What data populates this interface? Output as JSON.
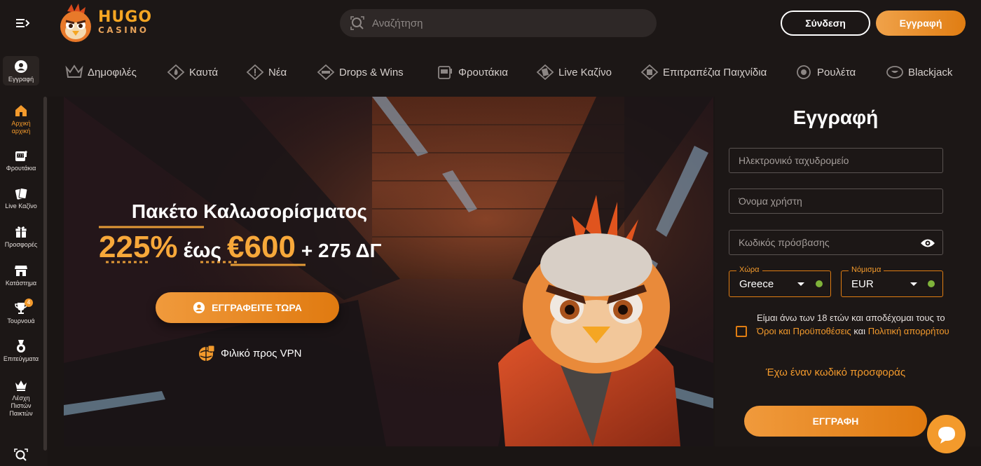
{
  "header": {
    "logo_text": "HUGO",
    "logo_sub": "CASINO",
    "search_placeholder": "Αναζήτηση",
    "login_label": "Σύνδεση",
    "register_label": "Εγγραφή"
  },
  "sidebar": {
    "items": [
      {
        "label": "Εγγραφή",
        "icon": "user-icon"
      },
      {
        "label": "Αρχική αρχική",
        "icon": "home-icon"
      },
      {
        "label": "Φρουτάκια",
        "icon": "slot-machine-icon"
      },
      {
        "label": "Live Καζίνο",
        "icon": "cards-icon"
      },
      {
        "label": "Προσφορές",
        "icon": "gift-icon"
      },
      {
        "label": "Κατάστημα",
        "icon": "store-icon"
      },
      {
        "label": "Τουρνουά",
        "icon": "trophy-icon",
        "badge": "4"
      },
      {
        "label": "Επιτεύγματα",
        "icon": "medal-icon"
      },
      {
        "label": "Λέσχη Πιστών Παικτών",
        "icon": "crown-icon"
      }
    ]
  },
  "categories": [
    {
      "label": "Δημοφιλές",
      "icon": "crown-icon"
    },
    {
      "label": "Καυτά",
      "icon": "fire-icon"
    },
    {
      "label": "Νέα",
      "icon": "new-icon"
    },
    {
      "label": "Drops & Wins",
      "icon": "drops-wins-icon"
    },
    {
      "label": "Φρουτάκια",
      "icon": "slot-machine-icon"
    },
    {
      "label": "Live Καζίνο",
      "icon": "cards-icon"
    },
    {
      "label": "Επιτραπέζια Παιχνίδια",
      "icon": "dice-icon"
    },
    {
      "label": "Ρουλέτα",
      "icon": "roulette-icon"
    },
    {
      "label": "Blackjack",
      "icon": "blackjack-icon"
    }
  ],
  "hero": {
    "title": "Πακέτο Καλωσορίσματος",
    "offer_percent": "225%",
    "offer_upto": "έως",
    "offer_amount": "€600",
    "offer_extra": "+ 275 ΔΓ",
    "cta_label": "ΕΓΓΡΑΦΕΙΤΕ ΤΩΡΑ",
    "vpn_label": "Φιλικό προς VPN"
  },
  "register_form": {
    "title": "Εγγραφή",
    "email_placeholder": "Ηλεκτρονικό ταχυδρομείο",
    "username_placeholder": "Όνομα χρήστη",
    "password_placeholder": "Κωδικός πρόσβασης",
    "country_label": "Χώρα",
    "country_value": "Greece",
    "currency_label": "Νόμισμα",
    "currency_value": "EUR",
    "terms_prefix": "Είμαι άνω των 18 ετών και αποδέχομαι τους το",
    "terms_link": "Όροι και Προϋποθέσεις",
    "terms_and": "και",
    "privacy_link": "Πολιτική απορρήτου",
    "promo_label": "Έχω έναν κωδικό προσφοράς",
    "submit_label": "ΕΓΓΡΑΦΗ"
  },
  "colors": {
    "accent": "#f39a2c",
    "background": "#1c1716"
  }
}
